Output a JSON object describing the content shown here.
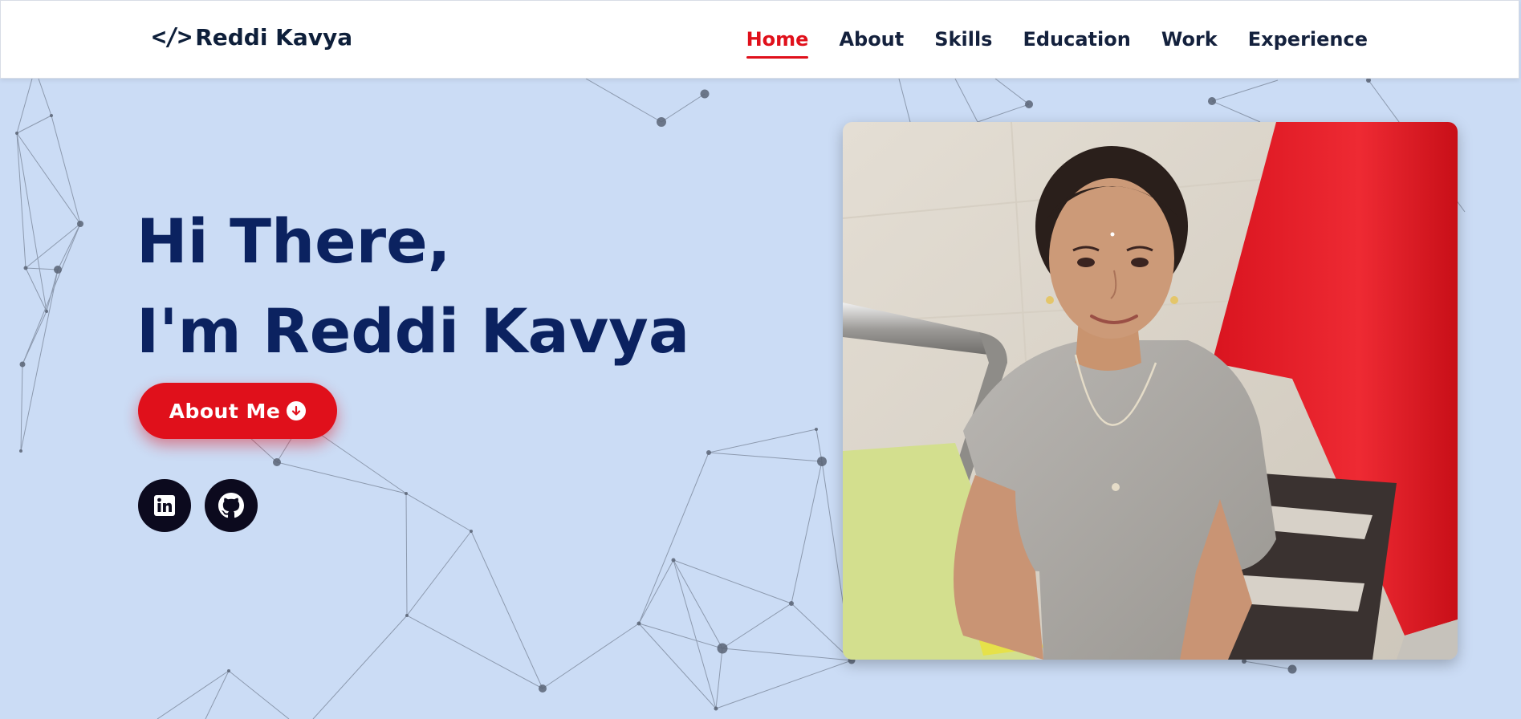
{
  "header": {
    "logo_text": "Reddi Kavya",
    "logo_icon": "code-icon",
    "nav": [
      {
        "label": "Home",
        "active": true
      },
      {
        "label": "About",
        "active": false
      },
      {
        "label": "Skills",
        "active": false
      },
      {
        "label": "Education",
        "active": false
      },
      {
        "label": "Work",
        "active": false
      },
      {
        "label": "Experience",
        "active": false
      }
    ]
  },
  "hero": {
    "greeting": "Hi There,",
    "intro": "I'm Reddi Kavya",
    "about_button": "About Me",
    "about_button_icon": "arrow-down-circle-icon",
    "social": [
      {
        "name": "linkedin-icon"
      },
      {
        "name": "github-icon"
      }
    ],
    "photo": "profile-photo"
  },
  "colors": {
    "accent": "#e0101b",
    "heading": "#0b2260",
    "background": "#cbdcf5",
    "nav_text": "#14213d",
    "social_bg": "#0c0a1e"
  }
}
